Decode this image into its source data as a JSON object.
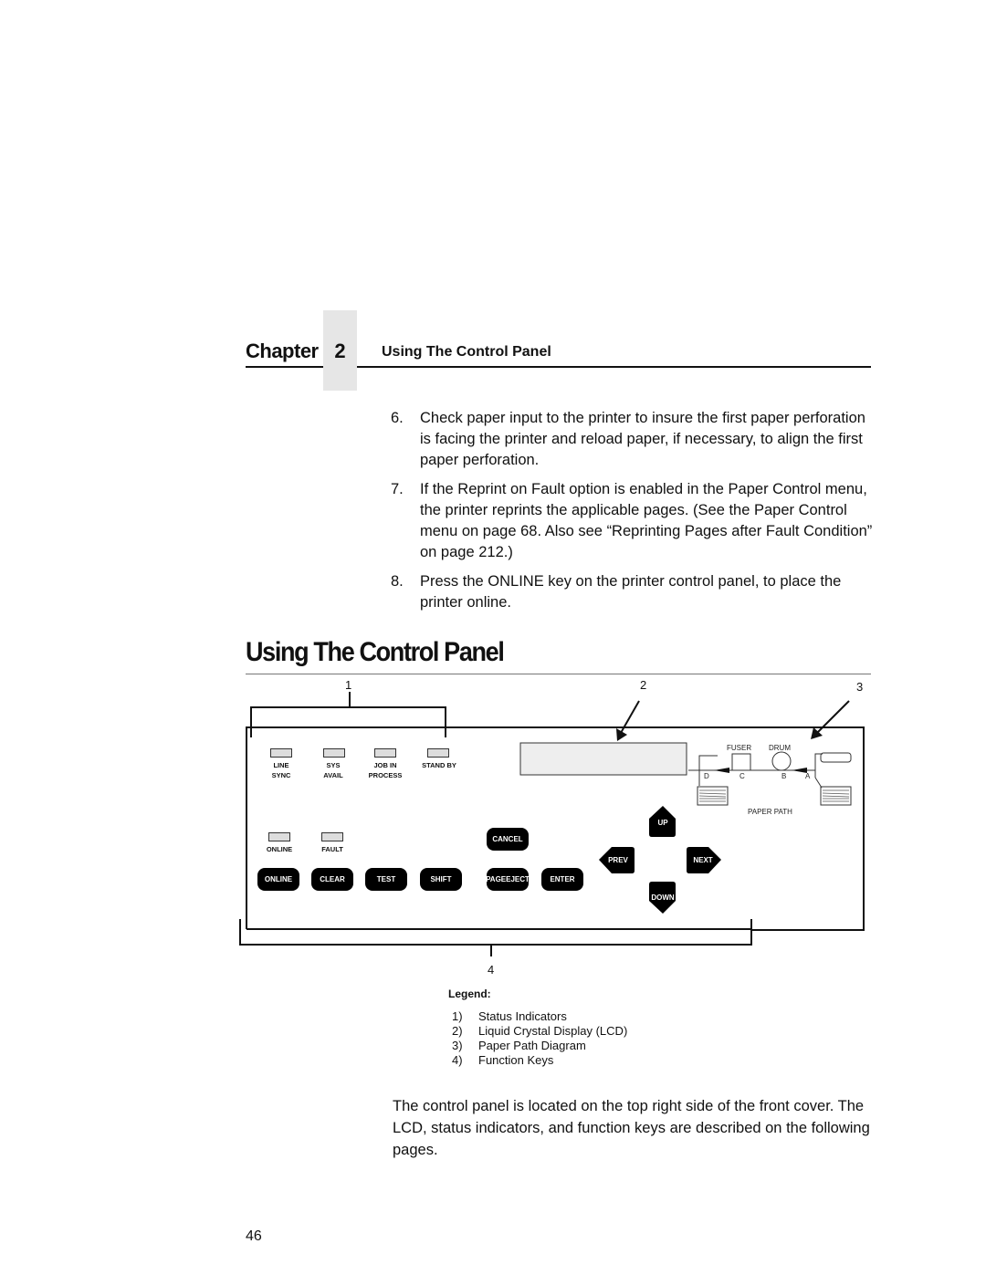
{
  "header": {
    "chapter_word": "Chapter",
    "chapter_number": "2",
    "chapter_title": "Using The Control Panel"
  },
  "steps": [
    {
      "num": "6.",
      "text": "Check paper input to the printer to insure the first paper perforation is facing the printer and reload paper, if necessary, to align the first paper perforation."
    },
    {
      "num": "7.",
      "text": "If the Reprint on Fault option is enabled in the Paper Control menu, the printer reprints the applicable pages. (See the Paper Control menu on page 68. Also see “Reprinting Pages after Fault Condition” on page 212.)"
    },
    {
      "num": "8.",
      "text": "Press the ONLINE key on the printer control panel, to place the printer online."
    }
  ],
  "section_title": "Using The Control Panel",
  "figure": {
    "callouts": [
      "1",
      "2",
      "3",
      "4"
    ],
    "status_indicators": [
      {
        "line1": "LINE",
        "line2": "SYNC"
      },
      {
        "line1": "SYS",
        "line2": "AVAIL"
      },
      {
        "line1": "JOB IN",
        "line2": "PROCESS"
      },
      {
        "line1": "STAND BY",
        "line2": ""
      }
    ],
    "lower_indicators": [
      "ONLINE",
      "FAULT"
    ],
    "function_keys": {
      "online": "ONLINE",
      "clear": "CLEAR",
      "test": "TEST",
      "shift": "SHIFT",
      "cancel": "CANCEL",
      "page_eject_1": "PAGE",
      "page_eject_2": "EJECT",
      "enter": "ENTER",
      "up": "UP",
      "down": "DOWN",
      "prev": "PREV",
      "next": "NEXT"
    },
    "paper_path": {
      "fuser": "FUSER",
      "drum": "DRUM",
      "points": [
        "D",
        "C",
        "B",
        "A"
      ],
      "label": "PAPER PATH"
    }
  },
  "legend": {
    "title": "Legend:",
    "items": [
      {
        "num": "1)",
        "text": "Status Indicators"
      },
      {
        "num": "2)",
        "text": "Liquid Crystal Display (LCD)"
      },
      {
        "num": "3)",
        "text": "Paper Path Diagram"
      },
      {
        "num": "4)",
        "text": "Function Keys"
      }
    ]
  },
  "closing_paragraph": "The control panel is located on the top right side of the front cover. The LCD, status indicators, and function keys are described on the following pages.",
  "page_number": "46"
}
